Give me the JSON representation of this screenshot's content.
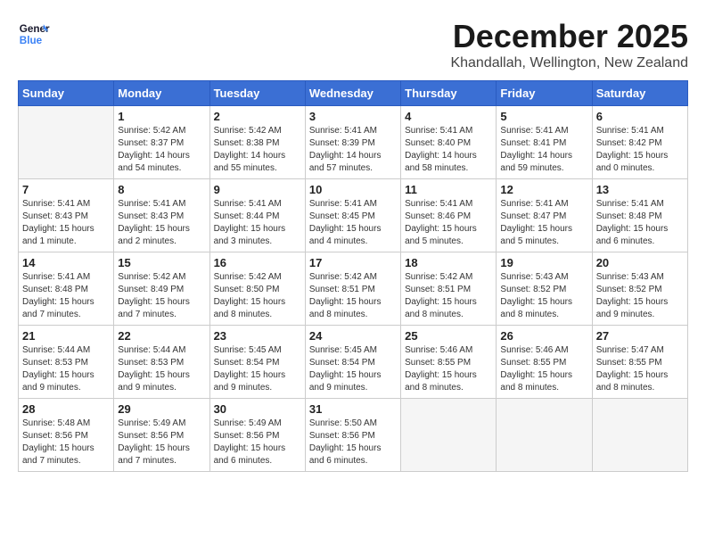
{
  "logo": {
    "line1": "General",
    "line2": "Blue"
  },
  "title": "December 2025",
  "subtitle": "Khandallah, Wellington, New Zealand",
  "days_of_week": [
    "Sunday",
    "Monday",
    "Tuesday",
    "Wednesday",
    "Thursday",
    "Friday",
    "Saturday"
  ],
  "weeks": [
    [
      {
        "day": "",
        "empty": true
      },
      {
        "day": "1",
        "sunrise": "5:42 AM",
        "sunset": "8:37 PM",
        "daylight": "14 hours and 54 minutes."
      },
      {
        "day": "2",
        "sunrise": "5:42 AM",
        "sunset": "8:38 PM",
        "daylight": "14 hours and 55 minutes."
      },
      {
        "day": "3",
        "sunrise": "5:41 AM",
        "sunset": "8:39 PM",
        "daylight": "14 hours and 57 minutes."
      },
      {
        "day": "4",
        "sunrise": "5:41 AM",
        "sunset": "8:40 PM",
        "daylight": "14 hours and 58 minutes."
      },
      {
        "day": "5",
        "sunrise": "5:41 AM",
        "sunset": "8:41 PM",
        "daylight": "14 hours and 59 minutes."
      },
      {
        "day": "6",
        "sunrise": "5:41 AM",
        "sunset": "8:42 PM",
        "daylight": "15 hours and 0 minutes."
      }
    ],
    [
      {
        "day": "7",
        "sunrise": "5:41 AM",
        "sunset": "8:43 PM",
        "daylight": "15 hours and 1 minute."
      },
      {
        "day": "8",
        "sunrise": "5:41 AM",
        "sunset": "8:43 PM",
        "daylight": "15 hours and 2 minutes."
      },
      {
        "day": "9",
        "sunrise": "5:41 AM",
        "sunset": "8:44 PM",
        "daylight": "15 hours and 3 minutes."
      },
      {
        "day": "10",
        "sunrise": "5:41 AM",
        "sunset": "8:45 PM",
        "daylight": "15 hours and 4 minutes."
      },
      {
        "day": "11",
        "sunrise": "5:41 AM",
        "sunset": "8:46 PM",
        "daylight": "15 hours and 5 minutes."
      },
      {
        "day": "12",
        "sunrise": "5:41 AM",
        "sunset": "8:47 PM",
        "daylight": "15 hours and 5 minutes."
      },
      {
        "day": "13",
        "sunrise": "5:41 AM",
        "sunset": "8:48 PM",
        "daylight": "15 hours and 6 minutes."
      }
    ],
    [
      {
        "day": "14",
        "sunrise": "5:41 AM",
        "sunset": "8:48 PM",
        "daylight": "15 hours and 7 minutes."
      },
      {
        "day": "15",
        "sunrise": "5:42 AM",
        "sunset": "8:49 PM",
        "daylight": "15 hours and 7 minutes."
      },
      {
        "day": "16",
        "sunrise": "5:42 AM",
        "sunset": "8:50 PM",
        "daylight": "15 hours and 8 minutes."
      },
      {
        "day": "17",
        "sunrise": "5:42 AM",
        "sunset": "8:51 PM",
        "daylight": "15 hours and 8 minutes."
      },
      {
        "day": "18",
        "sunrise": "5:42 AM",
        "sunset": "8:51 PM",
        "daylight": "15 hours and 8 minutes."
      },
      {
        "day": "19",
        "sunrise": "5:43 AM",
        "sunset": "8:52 PM",
        "daylight": "15 hours and 8 minutes."
      },
      {
        "day": "20",
        "sunrise": "5:43 AM",
        "sunset": "8:52 PM",
        "daylight": "15 hours and 9 minutes."
      }
    ],
    [
      {
        "day": "21",
        "sunrise": "5:44 AM",
        "sunset": "8:53 PM",
        "daylight": "15 hours and 9 minutes."
      },
      {
        "day": "22",
        "sunrise": "5:44 AM",
        "sunset": "8:53 PM",
        "daylight": "15 hours and 9 minutes."
      },
      {
        "day": "23",
        "sunrise": "5:45 AM",
        "sunset": "8:54 PM",
        "daylight": "15 hours and 9 minutes."
      },
      {
        "day": "24",
        "sunrise": "5:45 AM",
        "sunset": "8:54 PM",
        "daylight": "15 hours and 9 minutes."
      },
      {
        "day": "25",
        "sunrise": "5:46 AM",
        "sunset": "8:55 PM",
        "daylight": "15 hours and 8 minutes."
      },
      {
        "day": "26",
        "sunrise": "5:46 AM",
        "sunset": "8:55 PM",
        "daylight": "15 hours and 8 minutes."
      },
      {
        "day": "27",
        "sunrise": "5:47 AM",
        "sunset": "8:55 PM",
        "daylight": "15 hours and 8 minutes."
      }
    ],
    [
      {
        "day": "28",
        "sunrise": "5:48 AM",
        "sunset": "8:56 PM",
        "daylight": "15 hours and 7 minutes."
      },
      {
        "day": "29",
        "sunrise": "5:49 AM",
        "sunset": "8:56 PM",
        "daylight": "15 hours and 7 minutes."
      },
      {
        "day": "30",
        "sunrise": "5:49 AM",
        "sunset": "8:56 PM",
        "daylight": "15 hours and 6 minutes."
      },
      {
        "day": "31",
        "sunrise": "5:50 AM",
        "sunset": "8:56 PM",
        "daylight": "15 hours and 6 minutes."
      },
      {
        "day": "",
        "empty": true
      },
      {
        "day": "",
        "empty": true
      },
      {
        "day": "",
        "empty": true
      }
    ]
  ]
}
